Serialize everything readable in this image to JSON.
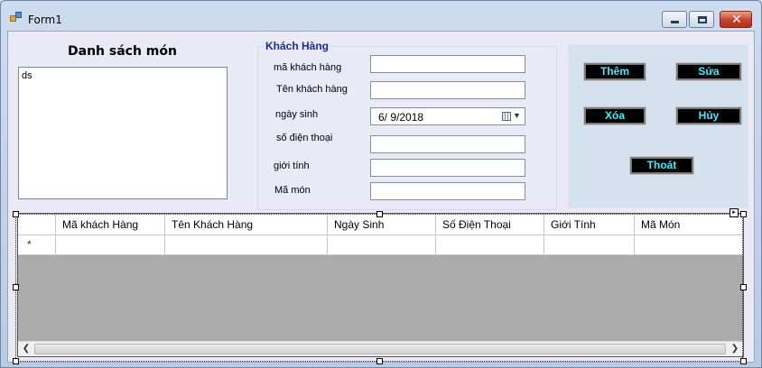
{
  "window": {
    "title": "Form1"
  },
  "list_panel": {
    "heading": "Danh sách món",
    "items": [
      "ds"
    ]
  },
  "customer_group": {
    "title": "Khách Hàng",
    "fields": [
      {
        "label": "mã khách hàng",
        "value": ""
      },
      {
        "label": "Tên khách hàng",
        "value": ""
      },
      {
        "label": "ngày sinh",
        "value": "6/  9/2018"
      },
      {
        "label": "số điện thoại",
        "value": ""
      },
      {
        "label": "giới tính",
        "value": ""
      },
      {
        "label": "Mã món",
        "value": ""
      }
    ]
  },
  "buttons": {
    "add": "Thêm",
    "edit": "Sửa",
    "delete": "Xóa",
    "cancel": "Hủy",
    "exit": "Thoát"
  },
  "grid": {
    "columns": [
      "Mã khách Hàng",
      "Tên Khách Hàng",
      "Ngày Sinh",
      "Số Điện Thoại",
      "Giới Tính",
      "Mã Món"
    ],
    "new_row_marker": "*"
  },
  "colors": {
    "button_bg": "#000000",
    "button_text": "#37f0ff",
    "group_title": "#1a2f8f"
  },
  "icons": {
    "app": "winforms-icon",
    "date_picker": "calendar-icon",
    "new_row": "asterisk-icon"
  }
}
